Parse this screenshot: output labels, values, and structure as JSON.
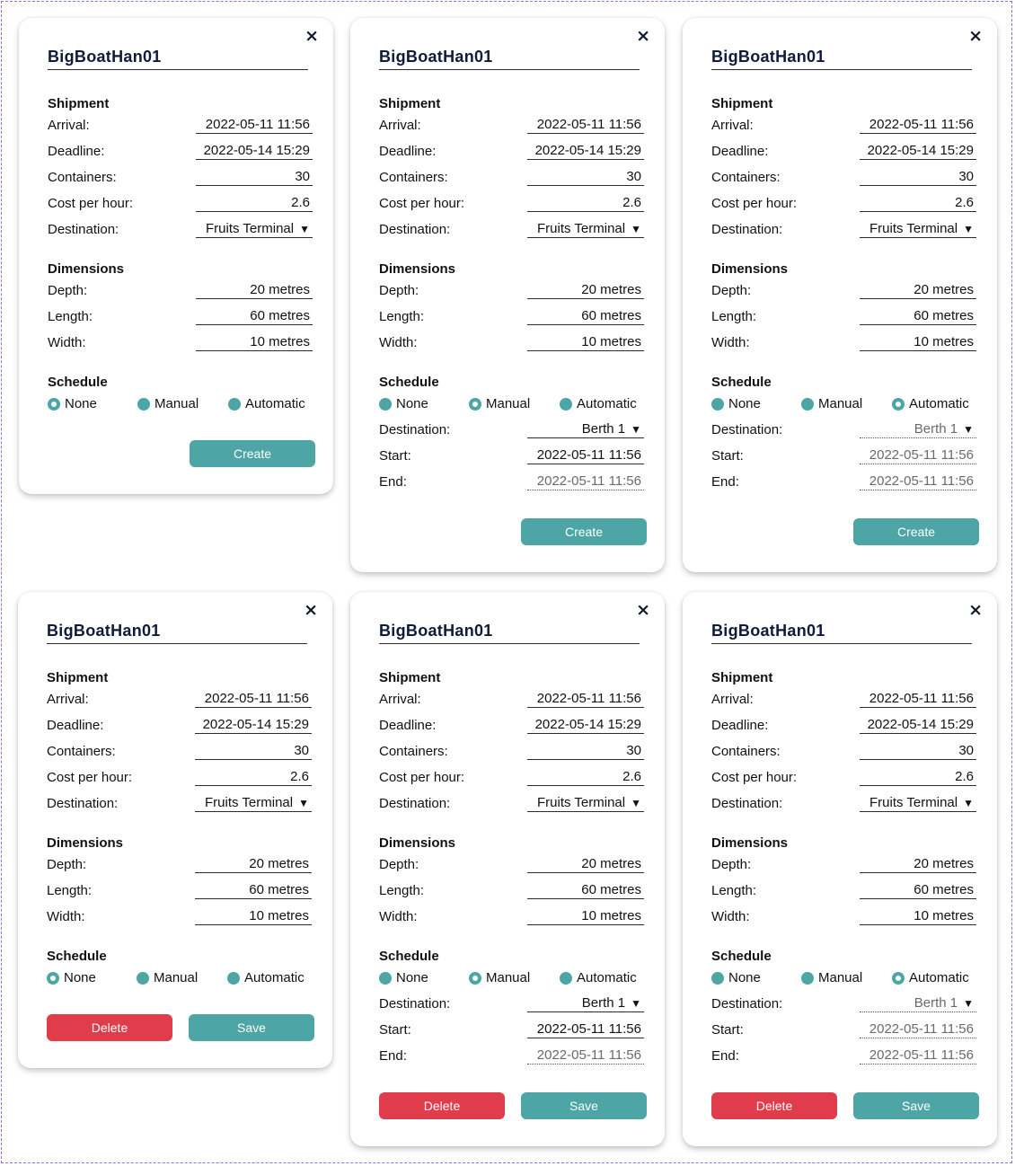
{
  "common": {
    "close_symbol": "×",
    "boat_name": "BigBoatHan01",
    "shipment": {
      "heading": "Shipment",
      "arrival_label": "Arrival:",
      "arrival_value": "2022-05-11 11:56",
      "deadline_label": "Deadline:",
      "deadline_value": "2022-05-14 15:29",
      "containers_label": "Containers:",
      "containers_value": "30",
      "cost_label": "Cost per hour:",
      "cost_value": "2.6",
      "destination_label": "Destination:",
      "destination_value": "Fruits Terminal"
    },
    "dimensions": {
      "heading": "Dimensions",
      "depth_label": "Depth:",
      "depth_value": "20 metres",
      "length_label": "Length:",
      "length_value": "60 metres",
      "width_label": "Width:",
      "width_value": "10 metres"
    },
    "schedule": {
      "heading": "Schedule",
      "none_label": "None",
      "manual_label": "Manual",
      "automatic_label": "Automatic",
      "destination_label": "Destination:",
      "destination_value": "Berth 1",
      "start_label": "Start:",
      "start_value": "2022-05-11 11:56",
      "end_label": "End:",
      "end_value": "2022-05-11 11:56"
    },
    "buttons": {
      "create": "Create",
      "delete": "Delete",
      "save": "Save"
    },
    "dropdown_arrow": "▼"
  },
  "cards": [
    {
      "variant": "create",
      "schedule_mode": "None"
    },
    {
      "variant": "create",
      "schedule_mode": "Manual"
    },
    {
      "variant": "create",
      "schedule_mode": "Automatic"
    },
    {
      "variant": "edit",
      "schedule_mode": "None"
    },
    {
      "variant": "edit",
      "schedule_mode": "Manual"
    },
    {
      "variant": "edit",
      "schedule_mode": "Automatic"
    }
  ],
  "colors": {
    "accent": "#4ea5a5",
    "danger": "#e03c4b",
    "title": "#0f1b38"
  }
}
